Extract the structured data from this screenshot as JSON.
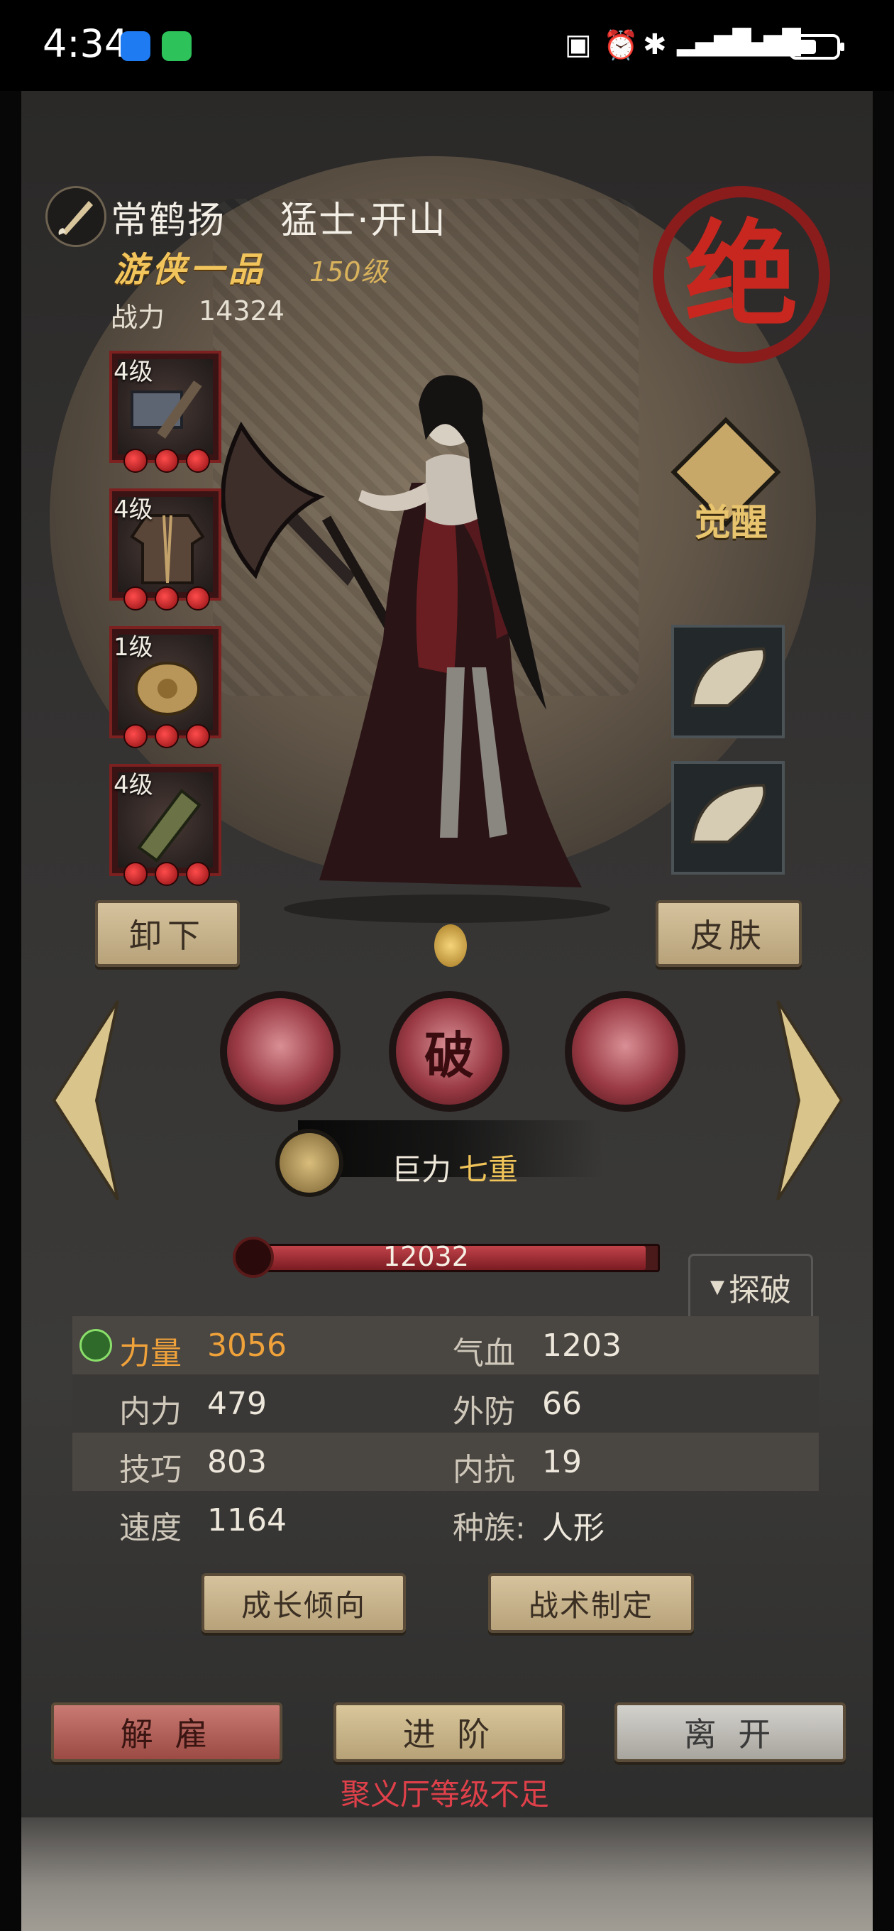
{
  "status_bar": {
    "time": "4:34"
  },
  "hero": {
    "name": "常鹤扬",
    "title": "猛士·开山",
    "sect_rank": "游侠一品",
    "level": "150级",
    "power_label": "战力",
    "power_value": "14324",
    "quality_seal": "绝"
  },
  "equipment": [
    {
      "level": "4级",
      "icon": "hammer-icon"
    },
    {
      "level": "4级",
      "icon": "robe-icon"
    },
    {
      "level": "1级",
      "icon": "amulet-icon"
    },
    {
      "level": "4级",
      "icon": "bracer-icon"
    }
  ],
  "accessories": [
    {
      "icon": "comb-icon"
    },
    {
      "icon": "comb-icon"
    }
  ],
  "awaken_label": "觉醒",
  "buttons": {
    "unequip": "卸下",
    "skin": "皮肤",
    "growth": "成长倾向",
    "tactics": "战术制定",
    "dismiss": "解 雇",
    "advance": "进 阶",
    "leave": "离 开"
  },
  "skills": [
    {
      "icon": "warrior-skill-icon",
      "glyph": ""
    },
    {
      "icon": "break-skill-icon",
      "glyph": "破"
    },
    {
      "icon": "rage-skill-icon",
      "glyph": ""
    }
  ],
  "passive": {
    "name": "巨力",
    "level": "七重"
  },
  "hp": {
    "value": "12032",
    "fill_fraction": 0.97
  },
  "explore_tab": "探破",
  "stats": [
    {
      "k1": "力量",
      "v1": "3056",
      "k2": "气血",
      "v2": "1203",
      "highlight": true
    },
    {
      "k1": "内力",
      "v1": "479",
      "k2": "外防",
      "v2": "66"
    },
    {
      "k1": "技巧",
      "v1": "803",
      "k2": "内抗",
      "v2": "19"
    },
    {
      "k1": "速度",
      "v1": "1164",
      "k2": "种族:",
      "v2": "人形"
    }
  ],
  "warning": "聚义厅等级不足",
  "colors": {
    "accent_gold": "#f0c459",
    "stat_highlight": "#f0a23a",
    "warning_red": "#e0404a",
    "seal_red": "#c7271f"
  }
}
